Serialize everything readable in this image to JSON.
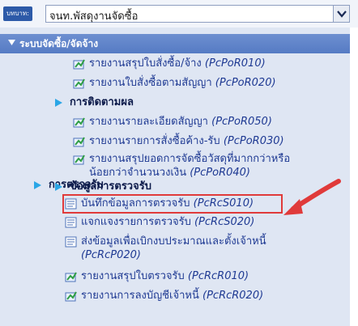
{
  "role": {
    "label": "บทบาท:",
    "value": "จนท.พัสดุงานจัดซื้อ"
  },
  "section_header": "ระบบจัดซื้อ/จัดจ้าง",
  "items": [
    {
      "th": "รายงานสรุปใบสั่งซื้อ/จ้าง ",
      "code": "(PcPoR010)",
      "icon": "report-icon"
    },
    {
      "th": "รายงานใบสั่งซื้อตามสัญญา ",
      "code": "(PcPoR020)",
      "icon": "report-icon"
    },
    {
      "group": "การติดตามผล"
    },
    {
      "th": "รายงานรายละเอียดสัญญา ",
      "code": "(PcPoR050)",
      "icon": "report-icon"
    },
    {
      "th": "รายงานรายการสั่งซื้อค้าง-รับ ",
      "code": "(PcPoR030)",
      "icon": "report-icon"
    },
    {
      "th": "รายงานสรุปยอดการจัดซื้อวัสดุที่มากกว่าหรือ",
      "th2": "น้อยกว่าจำนวนวงเงิน ",
      "code": "(PcPoR040)",
      "icon": "report-icon"
    },
    {
      "group": "การตรวจรับ"
    },
    {
      "group": "ข้อมูลการตรวจรับ"
    },
    {
      "th": "บันทึกข้อมูลการตรวจรับ ",
      "code": "(PcRcS010)",
      "icon": "form-icon"
    },
    {
      "th": "แจกแจงรายการตรวจรับ ",
      "code": "(PcRcS020)",
      "icon": "form-icon"
    },
    {
      "th": "ส่งข้อมูลเพื่อเบิกงบประมาณและตั้งเจ้าหนี้",
      "code": "(PcRcP020)",
      "icon": "form-icon"
    },
    {
      "th": "รายงานสรุปใบตรวจรับ ",
      "code": "(PcRcR010)",
      "icon": "report-icon"
    },
    {
      "th": "รายงานการลงบัญชีเจ้าหนี้ ",
      "code": "(PcRcR020)",
      "icon": "report-icon"
    }
  ],
  "colors": {
    "highlight": "#e03a3a",
    "arrow": "#e03a3a",
    "group_triangle": "#2aa6e6"
  }
}
